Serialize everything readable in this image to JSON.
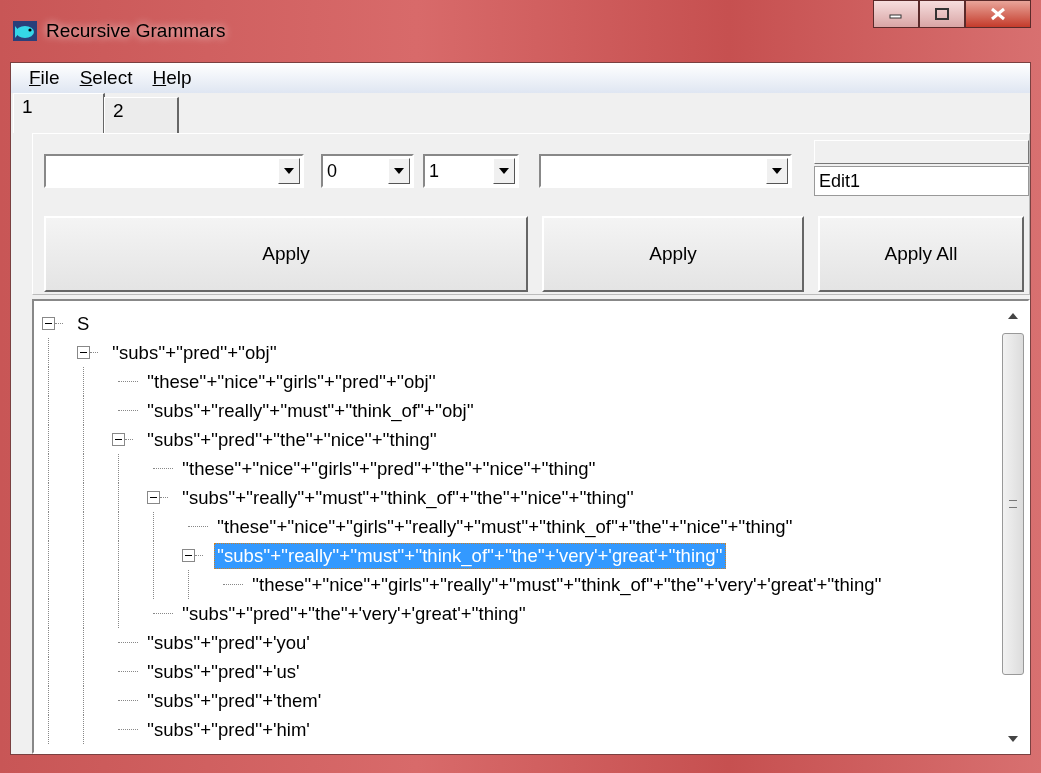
{
  "window": {
    "title": "Recursive Grammars"
  },
  "menu": [
    {
      "label": "File"
    },
    {
      "label": "Select"
    },
    {
      "label": "Help"
    }
  ],
  "tabs": [
    {
      "label": "1",
      "selected": true
    },
    {
      "label": "2",
      "selected": false
    }
  ],
  "number_combos": [
    {
      "value": "0"
    },
    {
      "value": "1"
    }
  ],
  "edit_field": {
    "value": "Edit1"
  },
  "buttons": [
    "Apply",
    "Apply",
    "Apply All"
  ],
  "tree": [
    {
      "label": "S",
      "expanded": true,
      "selected": false,
      "children": [
        {
          "label": "''subs''+''pred''+''obj''",
          "expanded": true,
          "selected": false,
          "children": [
            {
              "label": "''these''+''nice''+''girls''+''pred''+''obj''",
              "selected": false
            },
            {
              "label": "''subs''+''really''+''must''+''think_of''+''obj''",
              "selected": false
            },
            {
              "label": "''subs''+''pred''+''the''+''nice''+''thing''",
              "expanded": true,
              "selected": false,
              "children": [
                {
                  "label": "''these''+''nice''+''girls''+''pred''+''the''+''nice''+''thing''",
                  "selected": false
                },
                {
                  "label": "''subs''+''really''+''must''+''think_of''+''the''+''nice''+''thing''",
                  "expanded": true,
                  "selected": false,
                  "children": [
                    {
                      "label": "''these''+''nice''+''girls''+''really''+''must''+''think_of''+''the''+''nice''+''thing''",
                      "selected": false
                    },
                    {
                      "label": "''subs''+''really''+''must''+''think_of''+''the''+'very'+'great'+''thing''",
                      "expanded": true,
                      "selected": true,
                      "children": [
                        {
                          "label": "''these''+''nice''+''girls''+''really''+''must''+''think_of''+''the''+'very'+'great'+''thing''",
                          "selected": false
                        }
                      ]
                    }
                  ]
                },
                {
                  "label": "''subs''+''pred''+''the''+'very'+'great'+''thing''",
                  "selected": false
                }
              ]
            },
            {
              "label": "''subs''+''pred''+'you'",
              "selected": false
            },
            {
              "label": "''subs''+''pred''+'us'",
              "selected": false
            },
            {
              "label": "''subs''+''pred''+'them'",
              "selected": false
            },
            {
              "label": "''subs''+''pred''+'him'",
              "selected": false
            }
          ]
        }
      ]
    }
  ]
}
